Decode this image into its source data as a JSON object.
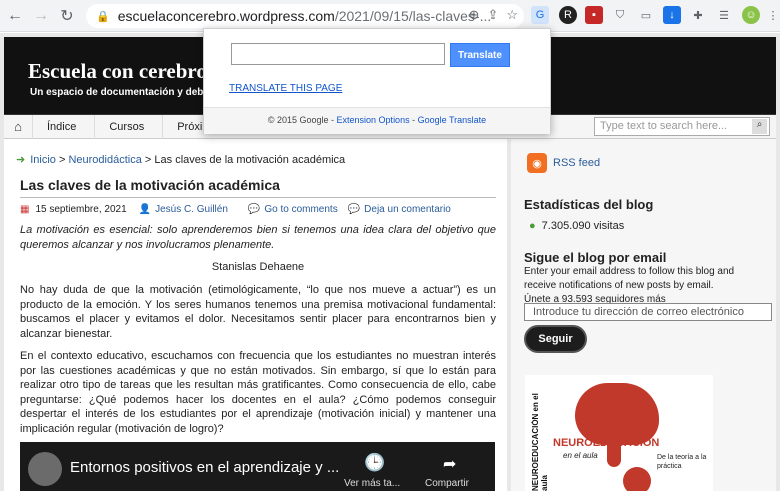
{
  "browser": {
    "url_host": "escuelaconcerebro.wordpress.com",
    "url_path": "/2021/09/15/las-claves-...",
    "back_icon": "back-arrow-icon",
    "forward_icon": "forward-arrow-icon",
    "reload_icon": "reload-icon"
  },
  "site": {
    "title": "Escuela con cerebro",
    "subtitle": "Un espacio de documentación y debate so"
  },
  "menu": {
    "items": [
      "Índice",
      "Cursos",
      "Próximam"
    ],
    "search_placeholder": "Type text to search here..."
  },
  "breadcrumb": {
    "home": "Inicio",
    "section": "Neurodidáctica",
    "current": "Las claves de la motivación académica",
    "sep": ">"
  },
  "post": {
    "title": "Las claves de la motivación académica",
    "date": "15 septiembre, 2021",
    "author": "Jesús C. Guillén",
    "go_comments": "Go to comments",
    "leave_comment": "Deja un comentario",
    "quote": "La motivación es esencial: solo aprenderemos bien si tenemos una idea clara del objetivo que queremos alcanzar y nos involucramos plenamente.",
    "quote_author": "Stanislas Dehaene",
    "p1": "No hay duda de que la motivación (etimológicamente, “lo que nos mueve a actuar”) es un producto de la emoción. Y los seres humanos tenemos una premisa motivacional fundamental: buscamos el placer y evitamos el dolor. Necesitamos sentir placer para encontrarnos bien y alcanzar bienestar.",
    "p2": "En el contexto educativo, escuchamos con frecuencia que los estudiantes no muestran interés por las cuestiones académicas y que no están motivados. Sin embargo, sí que lo están para realizar otro tipo de tareas que les resultan más gratificantes. Como consecuencia de ello, cabe preguntarse: ¿Qué podemos hacer los docentes en el aula? ¿Cómo podemos conseguir despertar el interés de los estudiantes por el aprendizaje (motivación inicial) y mantener una implicación regular (motivación de logro)?"
  },
  "video": {
    "title": "Entornos positivos en el aprendizaje y ...",
    "watch_later": "Ver más ta...",
    "share": "Compartir"
  },
  "sidebar": {
    "rss": "RSS feed",
    "stats_title": "Estadísticas del blog",
    "visits": "7.305.090 visitas",
    "follow_title": "Sigue el blog por email",
    "follow_text": "Enter your email address to follow this blog and receive notifications of new posts by email.",
    "followers": "Únete a 93.593 seguidores más",
    "email_placeholder": "Introduce tu dirección de correo electrónico",
    "follow_button": "Seguir"
  },
  "book": {
    "title": "NEUROEDUCACIÓN",
    "subtitle": "en el aula",
    "tag": "De la teoría a la práctica",
    "spine": "NEUROEDUCACIÓN en el aula"
  },
  "translate_popup": {
    "button": "Translate",
    "translate_page": "TRANSLATE THIS PAGE",
    "footer_copy": "© 2015 Google -",
    "options": "Extension Options",
    "footer_sep": "-",
    "gt": "Google Translate"
  },
  "colors": {
    "accent": "#4d90fe",
    "link": "#2a5c9a",
    "header_bg": "#111111",
    "rss": "#f26f21"
  }
}
